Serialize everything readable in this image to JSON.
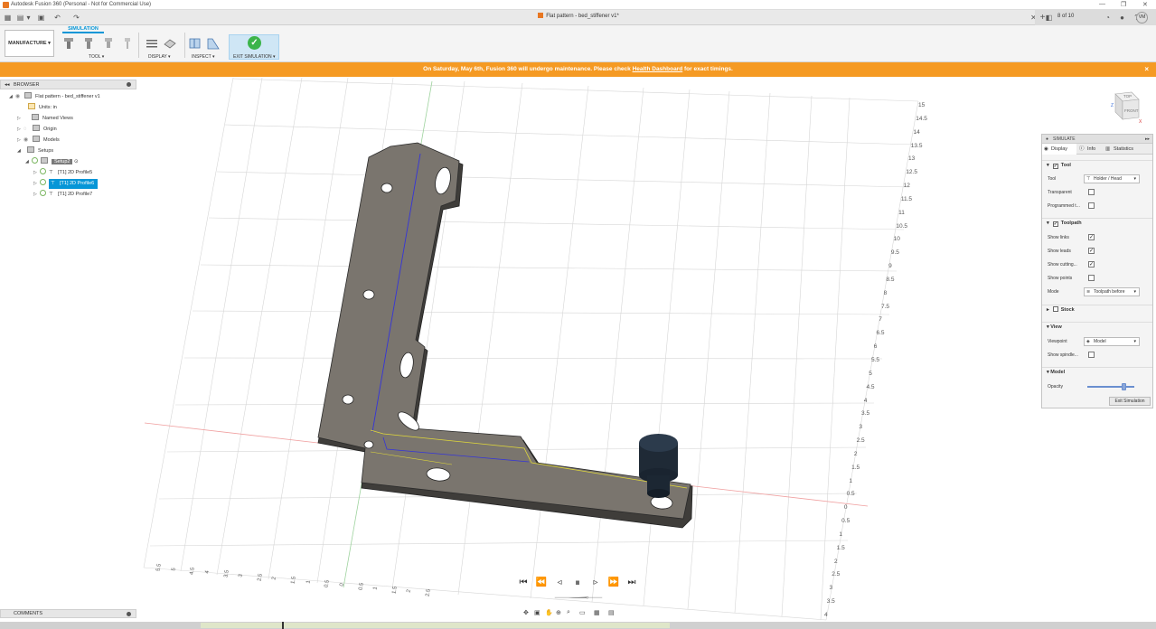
{
  "window": {
    "title": "Autodesk Fusion 360 (Personal - Not for Commercial Use)",
    "doc_title": "Flat pattern - bed_stiffener v1*",
    "jobs": "8 of 10",
    "user_initials": "VM"
  },
  "ribbon": {
    "workspace": "MANUFACTURE",
    "active_tab": "SIMULATION",
    "groups": {
      "tool": "TOOL",
      "display": "DISPLAY",
      "inspect": "INSPECT",
      "exit": "EXIT SIMULATION"
    }
  },
  "notice": {
    "text_before": "On Saturday, May 6th, Fusion 360 will undergo maintenance. Please check",
    "link": "Health Dashboard",
    "text_after": "for exact timings.",
    "close": "×"
  },
  "browser": {
    "header": "BROWSER",
    "items": [
      {
        "label": "Flat pattern - bed_stiffener v1"
      },
      {
        "label": "Units: in"
      },
      {
        "label": "Named Views"
      },
      {
        "label": "Origin"
      },
      {
        "label": "Models"
      },
      {
        "label": "Setups"
      },
      {
        "label": "Setup2"
      },
      {
        "label": "[T1] 2D Profile5"
      },
      {
        "label": "[T1] 2D Profile6"
      },
      {
        "label": "[T1] 2D Profile7"
      }
    ]
  },
  "comments": {
    "label": "COMMENTS"
  },
  "simulate": {
    "header": "SIMULATE",
    "tabs": {
      "display": "Display",
      "info": "Info",
      "statistics": "Statistics"
    },
    "tool_section": {
      "title": "Tool",
      "tool_label": "Tool",
      "tool_value": "Holder / Head",
      "transparent": "Transparent",
      "programmed": "Programmed t..."
    },
    "toolpath_section": {
      "title": "Toolpath",
      "show_links": "Show links",
      "show_leads": "Show leads",
      "show_cutting": "Show cutting...",
      "show_points": "Show points",
      "mode_label": "Mode",
      "mode_value": "Toolpath before"
    },
    "stock_section": {
      "title": "Stock"
    },
    "view_section": {
      "title": "View",
      "viewpoint_label": "Viewpoint",
      "viewpoint_value": "Model",
      "show_spindle": "Show spindle..."
    },
    "model_section": {
      "title": "Model",
      "opacity_label": "Opacity",
      "opacity": 0.78
    },
    "exit_button": "Exit Simulation"
  },
  "viewcube": {
    "top": "TOP",
    "front": "FRONT",
    "axis_z": "Z",
    "axis_x": "X"
  },
  "ruler_right": [
    "15",
    "14.5",
    "14",
    "13.5",
    "13",
    "12.5",
    "12",
    "11.5",
    "11",
    "10.5",
    "10",
    "9.5",
    "9",
    "8.5",
    "8",
    "7.5",
    "7",
    "6.5",
    "6",
    "5.5",
    "5",
    "4.5",
    "4",
    "3.5",
    "3",
    "2.5",
    "2",
    "1.5",
    "1",
    "0.5",
    "0",
    "0.5",
    "1",
    "1.5",
    "2",
    "2.5",
    "3",
    "3.5",
    "4"
  ],
  "ruler_bottom": [
    "5.5",
    "5",
    "4.5",
    "4",
    "3.5",
    "3",
    "2.5",
    "2",
    "1.5",
    "1",
    "0.5",
    "0",
    "0.5",
    "1",
    "1.5",
    "2",
    "2.5"
  ]
}
